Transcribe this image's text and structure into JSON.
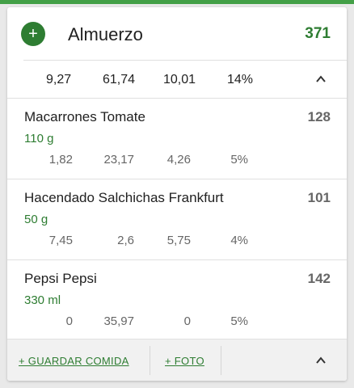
{
  "meal": {
    "title": "Almuerzo",
    "total_kcal": "371",
    "add_icon": "plus-icon",
    "summary": {
      "v1": "9,27",
      "v2": "61,74",
      "v3": "10,01",
      "pct": "14%"
    }
  },
  "foods": [
    {
      "name": "Macarrones Tomate",
      "kcal": "128",
      "qty": "110 g",
      "m1": "1,82",
      "m2": "23,17",
      "m3": "4,26",
      "pct": "5%"
    },
    {
      "name": "Hacendado Salchichas Frankfurt",
      "kcal": "101",
      "qty": "50 g",
      "m1": "7,45",
      "m2": "2,6",
      "m3": "5,75",
      "pct": "4%"
    },
    {
      "name": "Pepsi Pepsi",
      "kcal": "142",
      "qty": "330 ml",
      "m1": "0",
      "m2": "35,97",
      "m3": "0",
      "pct": "5%"
    }
  ],
  "footer": {
    "save_label": "+ GUARDAR COMIDA",
    "photo_label": "+ FOTO"
  },
  "colors": {
    "accent": "#2e7d32",
    "top_bar": "#43a047"
  }
}
